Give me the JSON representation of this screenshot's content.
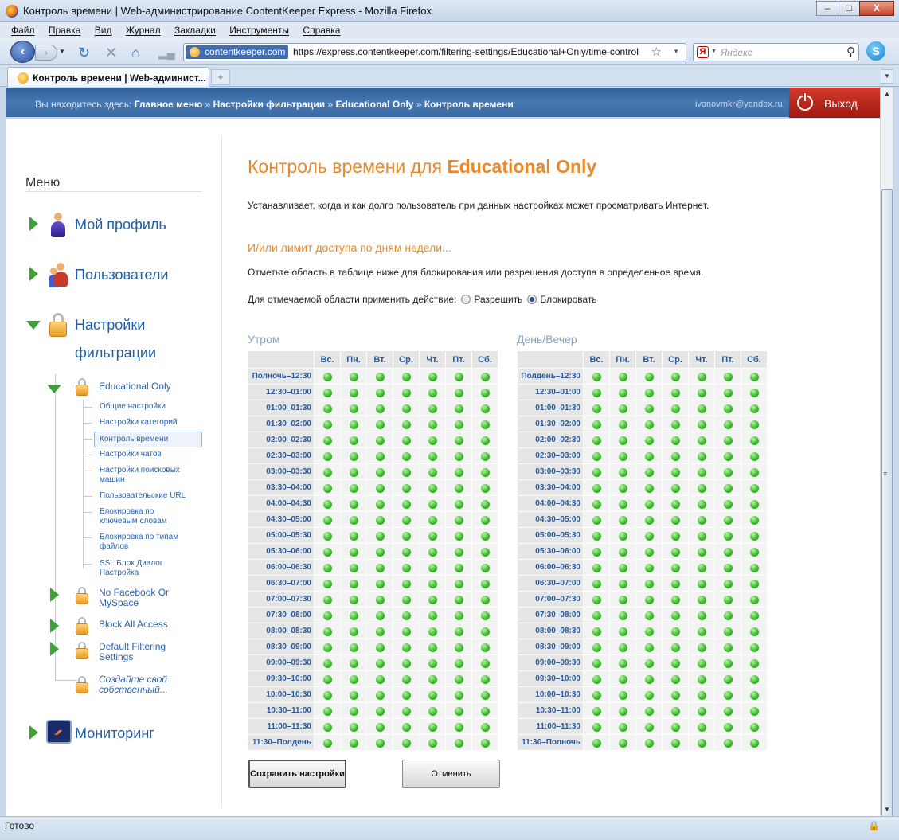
{
  "window": {
    "title": "Контроль времени | Web-администрирование ContentKeeper Express - Mozilla Firefox",
    "minimize": "–",
    "maximize": "□",
    "close": "X"
  },
  "menubar": [
    "Файл",
    "Правка",
    "Вид",
    "Журнал",
    "Закладки",
    "Инструменты",
    "Справка"
  ],
  "navbar": {
    "site_badge": "contentkeeper.com",
    "url": "https://express.contentkeeper.com/filtering-settings/Educational+Only/time-control",
    "search_placeholder": "Яндекс",
    "search_engine_icon": "Я"
  },
  "tabs": [
    {
      "label": "Контроль времени | Web-админист..."
    }
  ],
  "new_tab": "+",
  "header": {
    "breadcrumb_prefix": "Вы находитесь здесь:",
    "breadcrumbs": [
      "Главное меню",
      "Настройки фильтрации",
      "Educational Only",
      "Контроль времени"
    ],
    "separator": "»",
    "user_email": "ivanovmkr@yandex.ru",
    "logout_label": "Выход"
  },
  "sidebar": {
    "menu_title": "Меню",
    "main_items": [
      {
        "label": "Мой профиль"
      },
      {
        "label": "Пользователи"
      },
      {
        "label_line1": "Настройки",
        "label_line2": "фильтрации"
      },
      {
        "label": "Мониторинг"
      }
    ],
    "filter_profiles": [
      {
        "label": "Educational Only"
      },
      {
        "label_line1": "No Facebook Or",
        "label_line2": "MySpace"
      },
      {
        "label": "Block All Access"
      },
      {
        "label_line1": "Default Filtering",
        "label_line2": "Settings"
      },
      {
        "label_line1": "Создайте свой",
        "label_line2": "собственный..."
      }
    ],
    "sub_links": [
      {
        "label": "Общие настройки"
      },
      {
        "label": "Настройки категорий"
      },
      {
        "label": "Контроль времени"
      },
      {
        "label": "Настройки чатов"
      },
      {
        "label_line1": "Настройки поисковых",
        "label_line2": "машин"
      },
      {
        "label": "Пользовательские URL"
      },
      {
        "label_line1": "Блокировка по",
        "label_line2": "ключевым словам"
      },
      {
        "label_line1": "Блокировка по типам",
        "label_line2": "файлов"
      },
      {
        "label_line1": "SSL Блок Диалог",
        "label_line2": "Настройка"
      }
    ]
  },
  "main": {
    "title_prefix": "Контроль времени для ",
    "title_profile": "Educational Only",
    "description": "Устанавливает, когда и как долго пользователь при данных настройках может просматривать Интернет.",
    "section_title": "И/или лимит доступа по дням недели...",
    "instruction": "Отметьте область в таблице ниже для блокирования или разрешения доступа в определенное время.",
    "action_label": "Для отмечаемой области применить действие:",
    "action_allow": "Разрешить",
    "action_block": "Блокировать",
    "selected_action": "Блокировать",
    "days": [
      "Вс.",
      "Пн.",
      "Вт.",
      "Ср.",
      "Чт.",
      "Пт.",
      "Сб."
    ],
    "morning_label": "Утром",
    "evening_label": "День/Вечер",
    "morning_times": [
      "Полночь–12:30",
      "12:30–01:00",
      "01:00–01:30",
      "01:30–02:00",
      "02:00–02:30",
      "02:30–03:00",
      "03:00–03:30",
      "03:30–04:00",
      "04:00–04:30",
      "04:30–05:00",
      "05:00–05:30",
      "05:30–06:00",
      "06:00–06:30",
      "06:30–07:00",
      "07:00–07:30",
      "07:30–08:00",
      "08:00–08:30",
      "08:30–09:00",
      "09:00–09:30",
      "09:30–10:00",
      "10:00–10:30",
      "10:30–11:00",
      "11:00–11:30",
      "11:30–Полдень"
    ],
    "evening_times": [
      "Полдень–12:30",
      "12:30–01:00",
      "01:00–01:30",
      "01:30–02:00",
      "02:00–02:30",
      "02:30–03:00",
      "03:00–03:30",
      "03:30–04:00",
      "04:00–04:30",
      "04:30–05:00",
      "05:00–05:30",
      "05:30–06:00",
      "06:00–06:30",
      "06:30–07:00",
      "07:00–07:30",
      "07:30–08:00",
      "08:00–08:30",
      "08:30–09:00",
      "09:00–09:30",
      "09:30–10:00",
      "10:00–10:30",
      "10:30–11:00",
      "11:00–11:30",
      "11:30–Полночь"
    ],
    "cell_state": "allowed",
    "cell_color": "#3cbf2c",
    "save_button": "Сохранить настройки",
    "cancel_button": "Отменить"
  },
  "status": {
    "text": "Готово"
  },
  "colors": {
    "accent": "#e8892a",
    "header_blue": "#3a6aa3",
    "logout_red": "#c0281a",
    "link_blue": "#2c63a8"
  }
}
